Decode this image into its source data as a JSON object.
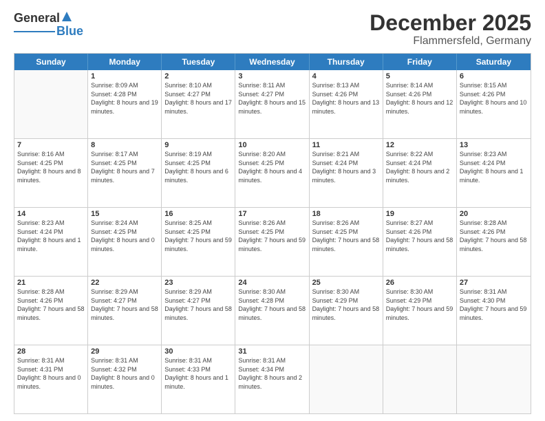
{
  "logo": {
    "general": "General",
    "blue": "Blue"
  },
  "title": "December 2025",
  "subtitle": "Flammersfeld, Germany",
  "weekdays": [
    "Sunday",
    "Monday",
    "Tuesday",
    "Wednesday",
    "Thursday",
    "Friday",
    "Saturday"
  ],
  "weeks": [
    [
      {
        "day": "",
        "sunrise": "",
        "sunset": "",
        "daylight": "",
        "empty": true
      },
      {
        "day": "1",
        "sunrise": "Sunrise: 8:09 AM",
        "sunset": "Sunset: 4:28 PM",
        "daylight": "Daylight: 8 hours and 19 minutes."
      },
      {
        "day": "2",
        "sunrise": "Sunrise: 8:10 AM",
        "sunset": "Sunset: 4:27 PM",
        "daylight": "Daylight: 8 hours and 17 minutes."
      },
      {
        "day": "3",
        "sunrise": "Sunrise: 8:11 AM",
        "sunset": "Sunset: 4:27 PM",
        "daylight": "Daylight: 8 hours and 15 minutes."
      },
      {
        "day": "4",
        "sunrise": "Sunrise: 8:13 AM",
        "sunset": "Sunset: 4:26 PM",
        "daylight": "Daylight: 8 hours and 13 minutes."
      },
      {
        "day": "5",
        "sunrise": "Sunrise: 8:14 AM",
        "sunset": "Sunset: 4:26 PM",
        "daylight": "Daylight: 8 hours and 12 minutes."
      },
      {
        "day": "6",
        "sunrise": "Sunrise: 8:15 AM",
        "sunset": "Sunset: 4:26 PM",
        "daylight": "Daylight: 8 hours and 10 minutes."
      }
    ],
    [
      {
        "day": "7",
        "sunrise": "Sunrise: 8:16 AM",
        "sunset": "Sunset: 4:25 PM",
        "daylight": "Daylight: 8 hours and 8 minutes."
      },
      {
        "day": "8",
        "sunrise": "Sunrise: 8:17 AM",
        "sunset": "Sunset: 4:25 PM",
        "daylight": "Daylight: 8 hours and 7 minutes."
      },
      {
        "day": "9",
        "sunrise": "Sunrise: 8:19 AM",
        "sunset": "Sunset: 4:25 PM",
        "daylight": "Daylight: 8 hours and 6 minutes."
      },
      {
        "day": "10",
        "sunrise": "Sunrise: 8:20 AM",
        "sunset": "Sunset: 4:25 PM",
        "daylight": "Daylight: 8 hours and 4 minutes."
      },
      {
        "day": "11",
        "sunrise": "Sunrise: 8:21 AM",
        "sunset": "Sunset: 4:24 PM",
        "daylight": "Daylight: 8 hours and 3 minutes."
      },
      {
        "day": "12",
        "sunrise": "Sunrise: 8:22 AM",
        "sunset": "Sunset: 4:24 PM",
        "daylight": "Daylight: 8 hours and 2 minutes."
      },
      {
        "day": "13",
        "sunrise": "Sunrise: 8:23 AM",
        "sunset": "Sunset: 4:24 PM",
        "daylight": "Daylight: 8 hours and 1 minute."
      }
    ],
    [
      {
        "day": "14",
        "sunrise": "Sunrise: 8:23 AM",
        "sunset": "Sunset: 4:24 PM",
        "daylight": "Daylight: 8 hours and 1 minute."
      },
      {
        "day": "15",
        "sunrise": "Sunrise: 8:24 AM",
        "sunset": "Sunset: 4:25 PM",
        "daylight": "Daylight: 8 hours and 0 minutes."
      },
      {
        "day": "16",
        "sunrise": "Sunrise: 8:25 AM",
        "sunset": "Sunset: 4:25 PM",
        "daylight": "Daylight: 7 hours and 59 minutes."
      },
      {
        "day": "17",
        "sunrise": "Sunrise: 8:26 AM",
        "sunset": "Sunset: 4:25 PM",
        "daylight": "Daylight: 7 hours and 59 minutes."
      },
      {
        "day": "18",
        "sunrise": "Sunrise: 8:26 AM",
        "sunset": "Sunset: 4:25 PM",
        "daylight": "Daylight: 7 hours and 58 minutes."
      },
      {
        "day": "19",
        "sunrise": "Sunrise: 8:27 AM",
        "sunset": "Sunset: 4:26 PM",
        "daylight": "Daylight: 7 hours and 58 minutes."
      },
      {
        "day": "20",
        "sunrise": "Sunrise: 8:28 AM",
        "sunset": "Sunset: 4:26 PM",
        "daylight": "Daylight: 7 hours and 58 minutes."
      }
    ],
    [
      {
        "day": "21",
        "sunrise": "Sunrise: 8:28 AM",
        "sunset": "Sunset: 4:26 PM",
        "daylight": "Daylight: 7 hours and 58 minutes."
      },
      {
        "day": "22",
        "sunrise": "Sunrise: 8:29 AM",
        "sunset": "Sunset: 4:27 PM",
        "daylight": "Daylight: 7 hours and 58 minutes."
      },
      {
        "day": "23",
        "sunrise": "Sunrise: 8:29 AM",
        "sunset": "Sunset: 4:27 PM",
        "daylight": "Daylight: 7 hours and 58 minutes."
      },
      {
        "day": "24",
        "sunrise": "Sunrise: 8:30 AM",
        "sunset": "Sunset: 4:28 PM",
        "daylight": "Daylight: 7 hours and 58 minutes."
      },
      {
        "day": "25",
        "sunrise": "Sunrise: 8:30 AM",
        "sunset": "Sunset: 4:29 PM",
        "daylight": "Daylight: 7 hours and 58 minutes."
      },
      {
        "day": "26",
        "sunrise": "Sunrise: 8:30 AM",
        "sunset": "Sunset: 4:29 PM",
        "daylight": "Daylight: 7 hours and 59 minutes."
      },
      {
        "day": "27",
        "sunrise": "Sunrise: 8:31 AM",
        "sunset": "Sunset: 4:30 PM",
        "daylight": "Daylight: 7 hours and 59 minutes."
      }
    ],
    [
      {
        "day": "28",
        "sunrise": "Sunrise: 8:31 AM",
        "sunset": "Sunset: 4:31 PM",
        "daylight": "Daylight: 8 hours and 0 minutes."
      },
      {
        "day": "29",
        "sunrise": "Sunrise: 8:31 AM",
        "sunset": "Sunset: 4:32 PM",
        "daylight": "Daylight: 8 hours and 0 minutes."
      },
      {
        "day": "30",
        "sunrise": "Sunrise: 8:31 AM",
        "sunset": "Sunset: 4:33 PM",
        "daylight": "Daylight: 8 hours and 1 minute."
      },
      {
        "day": "31",
        "sunrise": "Sunrise: 8:31 AM",
        "sunset": "Sunset: 4:34 PM",
        "daylight": "Daylight: 8 hours and 2 minutes."
      },
      {
        "day": "",
        "sunrise": "",
        "sunset": "",
        "daylight": "",
        "empty": true
      },
      {
        "day": "",
        "sunrise": "",
        "sunset": "",
        "daylight": "",
        "empty": true
      },
      {
        "day": "",
        "sunrise": "",
        "sunset": "",
        "daylight": "",
        "empty": true
      }
    ]
  ]
}
